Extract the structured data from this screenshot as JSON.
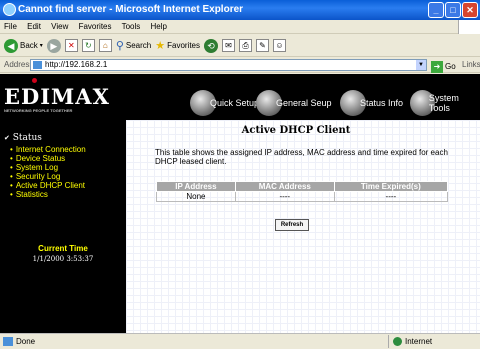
{
  "window": {
    "title": "Cannot find server - Microsoft Internet Explorer",
    "controls": [
      "_",
      "□",
      "✕"
    ]
  },
  "menubar": [
    "File",
    "Edit",
    "View",
    "Favorites",
    "Tools",
    "Help"
  ],
  "toolbar": {
    "back_label": "Back",
    "search_label": "Search",
    "favorites_label": "Favorites"
  },
  "address": {
    "label": "Address",
    "url": "http://192.168.2.1",
    "go_label": "Go",
    "links_label": "Links"
  },
  "brand": {
    "logo_text": "EDIMAX",
    "tagline": "NETWORKING PEOPLE TOGETHER"
  },
  "nav": {
    "quick_setup": "Quick Setup",
    "general_setup": "General Seup",
    "status_info": "Status Info",
    "system_tools": "System Tools"
  },
  "sidebar": {
    "title": "Status",
    "items": [
      "Internet Connection",
      "Device Status",
      "System Log",
      "Security Log",
      "Active DHCP Client",
      "Statistics"
    ],
    "current_time_label": "Current Time",
    "current_time_value": "1/1/2000 3:53:37"
  },
  "main": {
    "title": "Active DHCP Client",
    "description": "This table shows the assigned IP address, MAC address and time expired for each DHCP leased client.",
    "table": {
      "headers": [
        "IP Address",
        "MAC Address",
        "Time Expired(s)"
      ],
      "rows": [
        [
          "None",
          "----",
          "----"
        ]
      ]
    },
    "refresh_label": "Refresh"
  },
  "statusbar": {
    "status": "Done",
    "zone": "Internet"
  },
  "colors": {
    "title_bar": "#0b54c9",
    "sidebar_bg": "#000000",
    "sidebar_text": "#ffff00",
    "table_header_bg": "#a6a6a6"
  }
}
